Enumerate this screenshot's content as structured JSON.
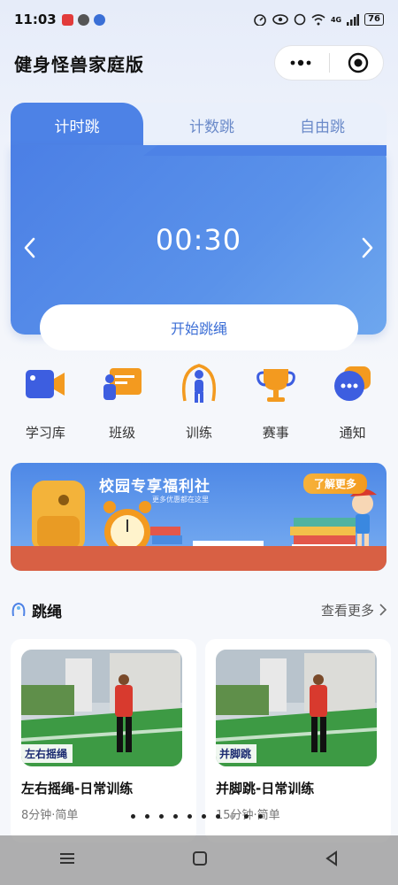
{
  "status_bar": {
    "time": "11:03",
    "battery": "76",
    "network": "4G"
  },
  "header": {
    "title": "健身怪兽家庭版"
  },
  "timer_card": {
    "tabs": [
      {
        "label": "计时跳",
        "active": true
      },
      {
        "label": "计数跳",
        "active": false
      },
      {
        "label": "自由跳",
        "active": false
      }
    ],
    "time_value": "00:30",
    "start_button": "开始跳绳"
  },
  "quick_menu": [
    {
      "label": "学习库",
      "icon": "video-camera-icon"
    },
    {
      "label": "班级",
      "icon": "classroom-icon"
    },
    {
      "label": "训练",
      "icon": "jump-rope-icon"
    },
    {
      "label": "赛事",
      "icon": "trophy-icon"
    },
    {
      "label": "通知",
      "icon": "chat-bubble-icon"
    }
  ],
  "banner": {
    "title": "校园专享福利社",
    "subtitle": "更多优惠都在这里",
    "more_button": "了解更多"
  },
  "section": {
    "title": "跳绳",
    "see_more": "查看更多"
  },
  "cards": [
    {
      "tag": "左右摇绳",
      "title": "左右摇绳-日常训练",
      "meta": "8分钟·简单"
    },
    {
      "tag": "并脚跳",
      "title": "并脚跳-日常训练",
      "meta": "15分钟·简单"
    }
  ],
  "colors": {
    "primary": "#4d82e6",
    "accent_orange": "#f39a1f",
    "text_dark": "#111111"
  }
}
